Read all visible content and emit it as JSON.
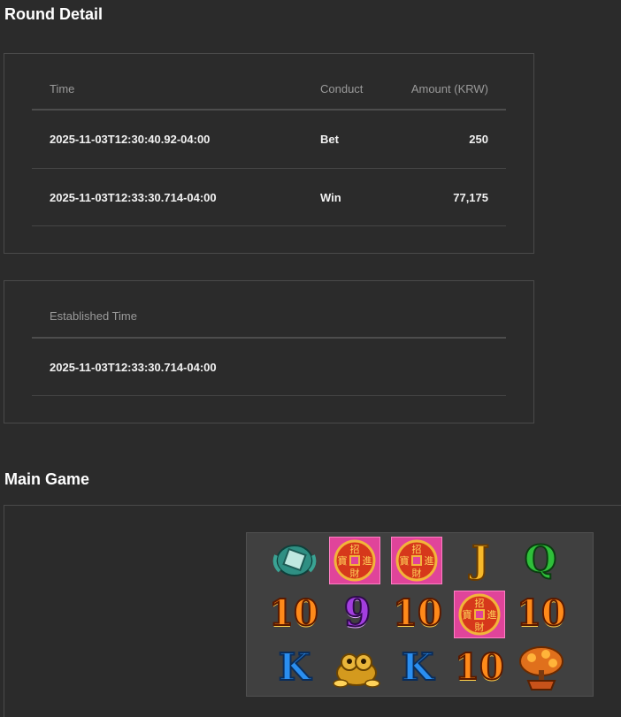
{
  "round_detail": {
    "title": "Round Detail",
    "columns": {
      "time": "Time",
      "conduct": "Conduct",
      "amount": "Amount (KRW)"
    },
    "rows": [
      {
        "time": "2025-11-03T12:30:40.92-04:00",
        "conduct": "Bet",
        "amount": "250"
      },
      {
        "time": "2025-11-03T12:33:30.714-04:00",
        "conduct": "Win",
        "amount": "77,175"
      }
    ]
  },
  "established": {
    "header": "Established Time",
    "value": "2025-11-03T12:33:30.714-04:00"
  },
  "main_game": {
    "title": "Main Game",
    "grid": [
      [
        "jade-dragon",
        "coin",
        "coin",
        "J",
        "Q"
      ],
      [
        "10",
        "9",
        "10",
        "coin",
        "10"
      ],
      [
        "K",
        "golden-toad",
        "K",
        "10",
        "money-tree"
      ]
    ],
    "symbols": {
      "ten": "10",
      "nine": "9",
      "jack": "J",
      "queen": "Q",
      "king": "K"
    },
    "coin_chars": [
      "招",
      "寶",
      "進",
      "財"
    ]
  }
}
